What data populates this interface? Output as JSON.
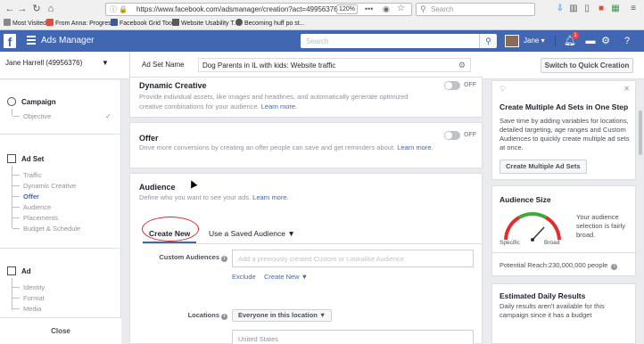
{
  "browser": {
    "url": "https://www.facebook.com/adsmanager/creation?act=49956376",
    "zoom": "120%",
    "search_placeholder": "Search",
    "bookmarks": [
      {
        "label": "Most Visited",
        "color": "#888888"
      },
      {
        "label": "From Anna: Progres...",
        "color": "#e34b3f"
      },
      {
        "label": "Facebook Grid Tool",
        "color": "#3b5998"
      },
      {
        "label": "Website Usability T...",
        "color": "#5a5a5a"
      },
      {
        "label": "Becoming huff po st...",
        "color": "#555555"
      }
    ]
  },
  "fb_header": {
    "app_title": "Ads Manager",
    "search_placeholder": "Search",
    "user_name": "Jane",
    "notification_count": "1",
    "brand_color": "#4267b2"
  },
  "subheader": {
    "account": "Jane Harrell (49956376)",
    "ad_set_label": "Ad Set Name",
    "ad_set_value": "Dog Parents in IL with kids: Website traffic",
    "quick_button": "Switch to Quick Creation"
  },
  "left_nav": {
    "campaign": {
      "title": "Campaign",
      "items": [
        "Objective"
      ]
    },
    "ad_set": {
      "title": "Ad Set",
      "items": [
        "Traffic",
        "Dynamic Creative",
        "Offer",
        "Audience",
        "Placements",
        "Budget & Schedule"
      ],
      "active": "Offer"
    },
    "ad": {
      "title": "Ad",
      "items": [
        "Identity",
        "Format",
        "Media"
      ]
    },
    "close_label": "Close"
  },
  "main": {
    "dynamic_creative": {
      "title": "Dynamic Creative",
      "desc": "Provide individual assets, like images and headlines, and automatically generate optimized creative combinations for your audience.",
      "link": "Learn more.",
      "toggle": "OFF"
    },
    "offer": {
      "title": "Offer",
      "desc": "Drive more conversions by creating an offer people can save and get reminders about.",
      "link": "Learn more.",
      "toggle": "OFF"
    },
    "audience": {
      "title": "Audience",
      "desc": "Define who you want to see your ads.",
      "link": "Learn more.",
      "tab_new": "Create New",
      "tab_saved": "Use a Saved Audience ▼",
      "custom_label": "Custom Audiences",
      "custom_placeholder": "Add a previously created Custom or Lookalike Audience",
      "exclude": "Exclude",
      "create_new": "Create New ▼",
      "locations_label": "Locations",
      "locations_select": "Everyone in this location ▼",
      "location_value": "United States"
    }
  },
  "right": {
    "multi": {
      "title": "Create Multiple Ad Sets in One Step",
      "text": "Save time by adding variables for locations, detailed targeting, age ranges and Custom Audiences to quickly create multiple ad sets at once.",
      "button": "Create Multiple Ad Sets"
    },
    "size": {
      "title": "Audience Size",
      "text": "Your audience selection is fairly broad.",
      "specific": "Specific",
      "broad": "Broad",
      "reach": "Potential Reach:230,000,000 people"
    },
    "daily": {
      "title": "Estimated Daily Results",
      "text": "Daily results aren't available for this campaign since it has a budget"
    }
  }
}
